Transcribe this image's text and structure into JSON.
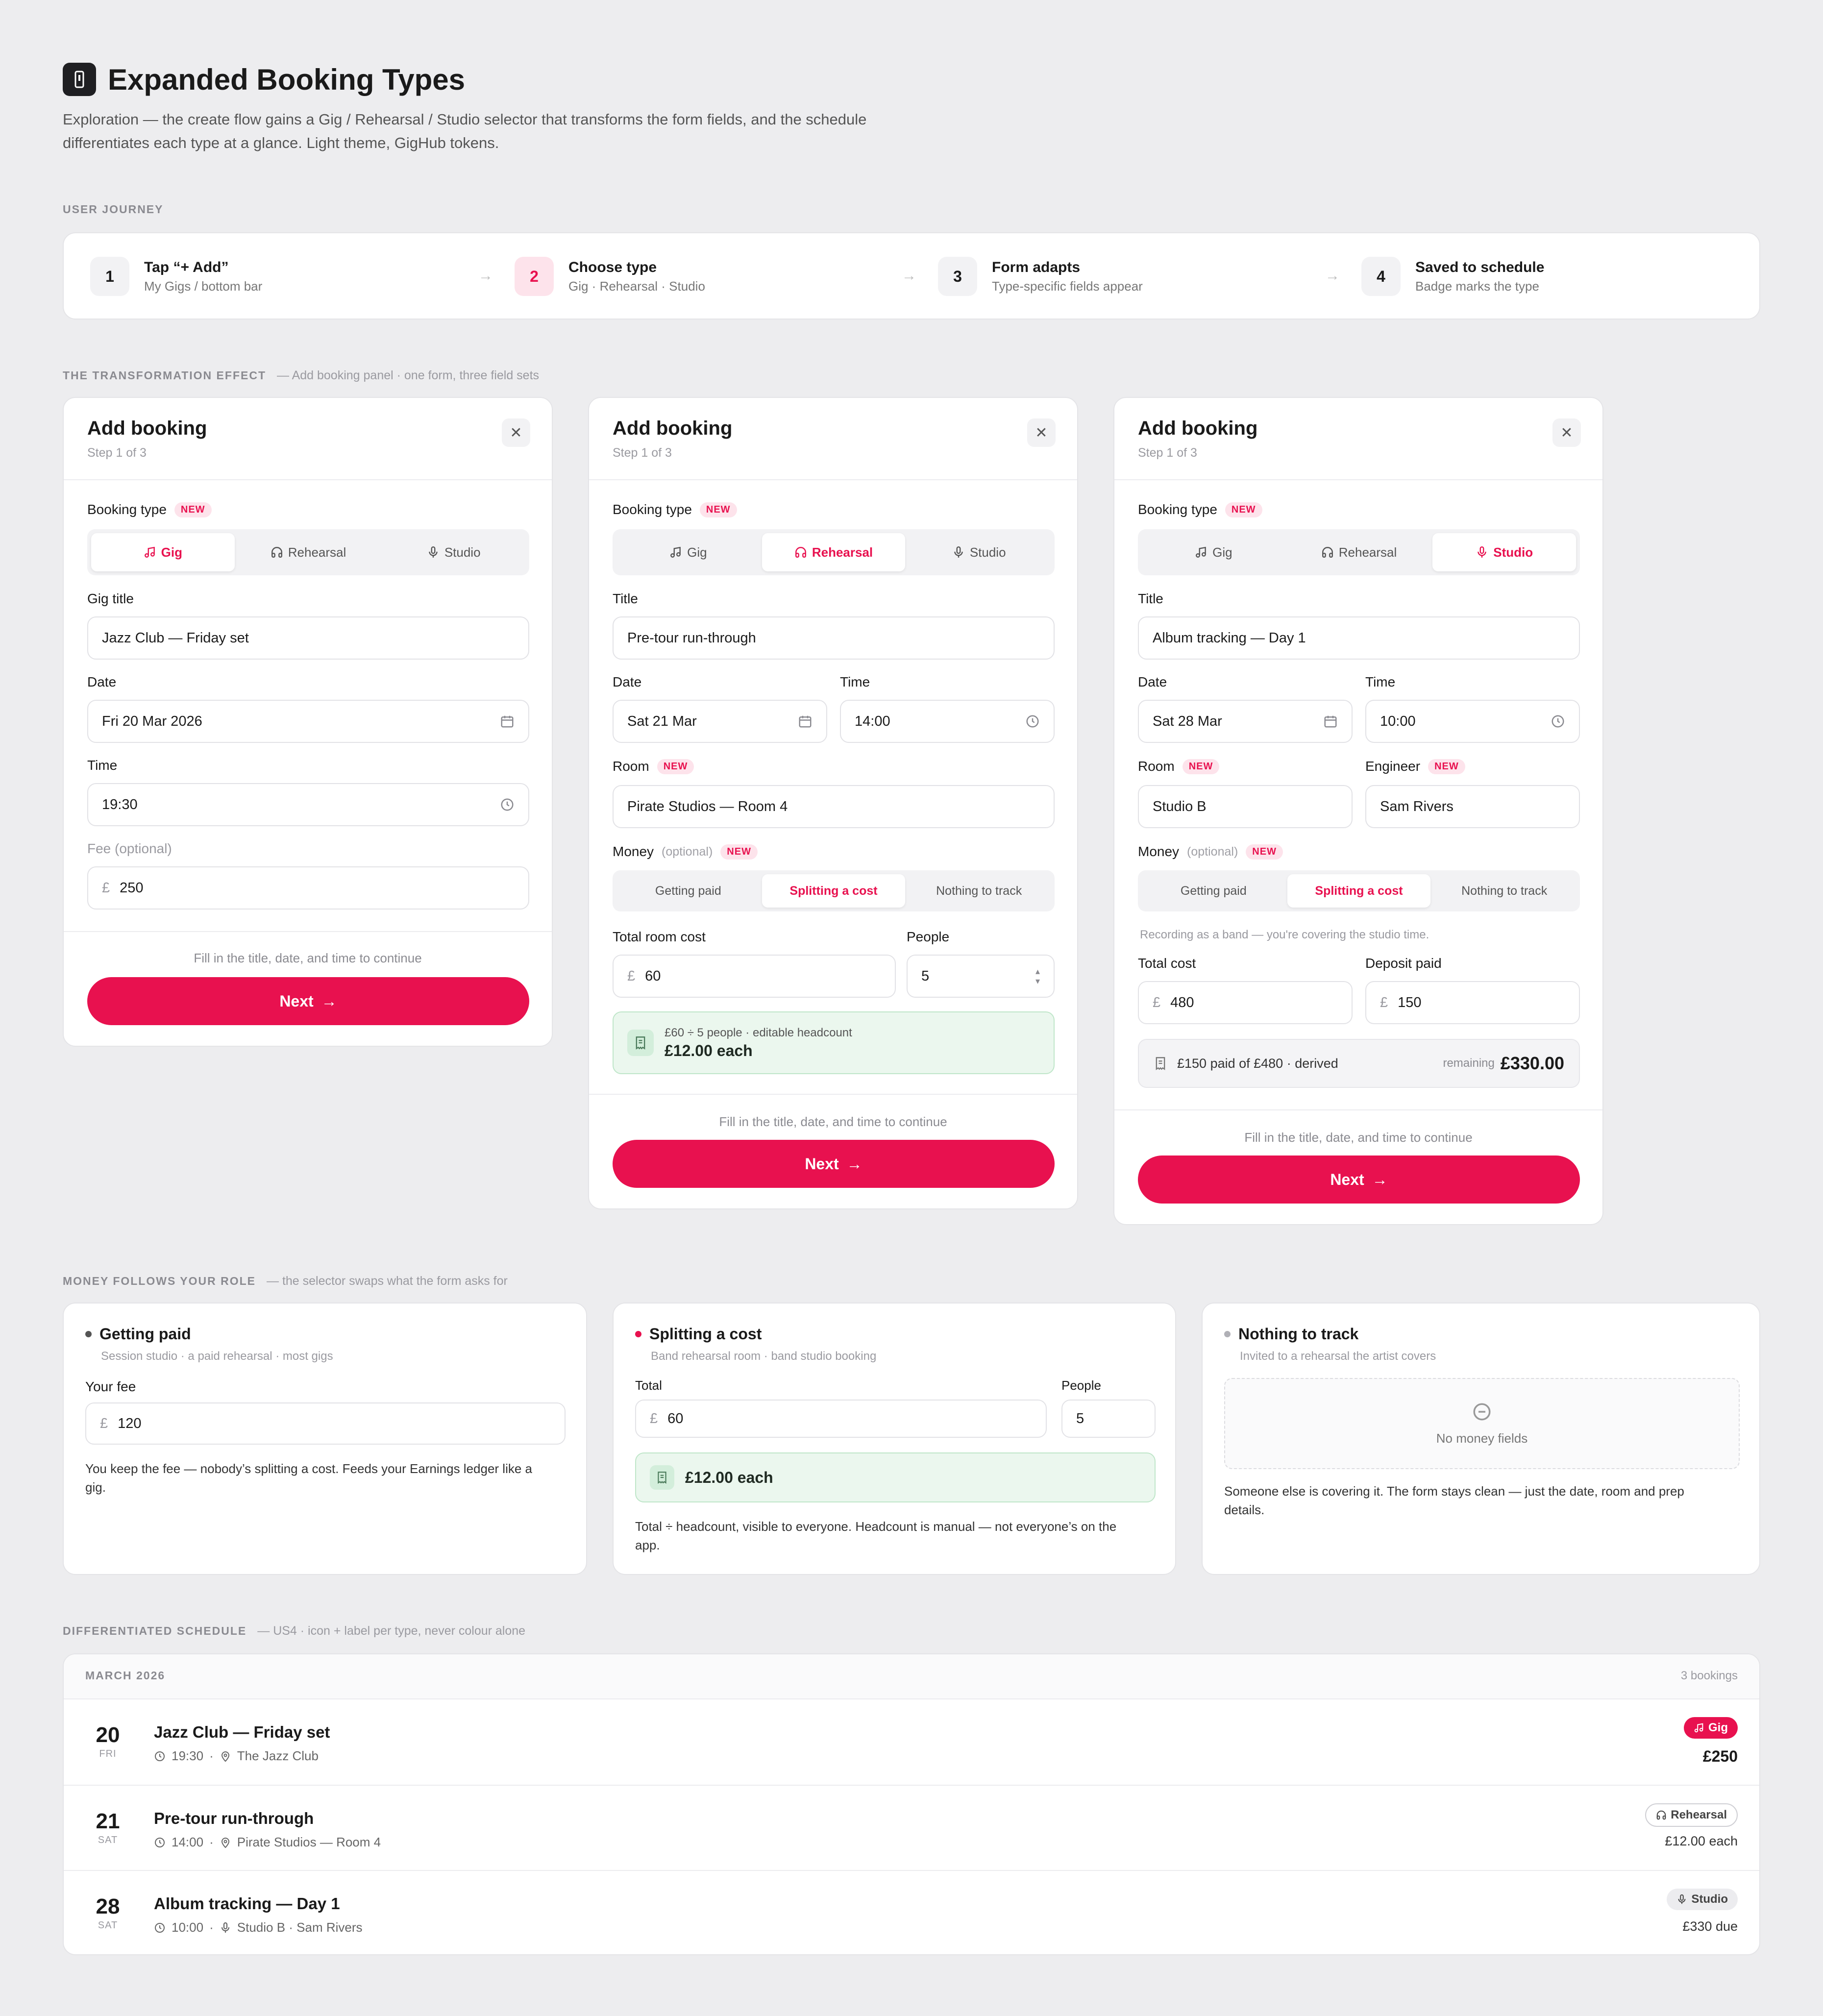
{
  "header": {
    "title": "Expanded Booking Types",
    "desc_line1": "Exploration — the create flow gains a Gig / Rehearsal / Studio selector that transforms the form fields, and the schedule",
    "desc_line2": "differentiates each type at a glance. Light theme, GigHub tokens.",
    "logo_icon": "phone-icon"
  },
  "journey": {
    "label": "USER JOURNEY",
    "steps": [
      {
        "num": "1",
        "title": "Tap “+ Add”",
        "sub": "My Gigs / bottom bar"
      },
      {
        "num": "2",
        "title": "Choose type",
        "sub": "Gig · Rehearsal · Studio"
      },
      {
        "num": "3",
        "title": "Form adapts",
        "sub": "Type-specific fields appear"
      },
      {
        "num": "4",
        "title": "Saved to schedule",
        "sub": "Badge marks the type"
      }
    ]
  },
  "transform": {
    "label": "THE TRANSFORMATION EFFECT",
    "sub": "— Add booking panel · one form, three field sets"
  },
  "common": {
    "panel_title": "Add booking",
    "panel_step": "Step 1 of 3",
    "booking_type_label": "Booking type",
    "new_badge": "NEW",
    "types": [
      "Gig",
      "Rehearsal",
      "Studio"
    ],
    "hint": "Fill in the title, date, and time to continue",
    "next": "Next",
    "currency": "£",
    "money_label": "Money",
    "money_optional": "(optional)",
    "money_options": [
      "Getting paid",
      "Splitting a cost",
      "Nothing to track"
    ],
    "accent": "#e8114f"
  },
  "gig_panel": {
    "title_label": "Gig title",
    "title_value": "Jazz Club — Friday set",
    "date_label": "Date",
    "date_value": "Fri 20 Mar 2026",
    "time_label": "Time",
    "time_value": "19:30",
    "fee_label": "Fee (optional)",
    "fee_value": "250"
  },
  "rehearsal_panel": {
    "title_label": "Title",
    "title_value": "Pre-tour run-through",
    "date_label": "Date",
    "date_value": "Sat 21 Mar",
    "time_label": "Time",
    "time_value": "14:00",
    "room_label": "Room",
    "room_value": "Pirate Studios — Room 4",
    "total_label": "Total room cost",
    "total_value": "60",
    "people_label": "People",
    "people_value": "5",
    "calc_line": "£60 ÷ 5 people · editable headcount",
    "calc_value": "£12.00 each"
  },
  "studio_panel": {
    "title_label": "Title",
    "title_value": "Album tracking — Day 1",
    "date_label": "Date",
    "date_value": "Sat 28 Mar",
    "time_label": "Time",
    "time_value": "10:00",
    "room_label": "Room",
    "room_value": "Studio B",
    "engineer_label": "Engineer",
    "engineer_value": "Sam Rivers",
    "note": "Recording as a band — you're covering the studio time.",
    "total_label": "Total cost",
    "total_value": "480",
    "deposit_label": "Deposit paid",
    "deposit_value": "150",
    "summary_text": "£150 paid of £480 · derived",
    "remaining_label": "remaining",
    "remaining_value": "£330.00"
  },
  "money": {
    "label": "MONEY FOLLOWS YOUR ROLE",
    "sub": "— the selector swaps what the form asks for",
    "paid": {
      "title": "Getting paid",
      "sub": "Session studio · a paid rehearsal · most gigs",
      "fee_label": "Your fee",
      "fee_value": "120",
      "desc_line1": "You keep the fee — nobody’s splitting a cost. Feeds your Earnings ledger like a",
      "desc_line2": "gig."
    },
    "split": {
      "title": "Splitting a cost",
      "sub": "Band rehearsal room · band studio booking",
      "total_label": "Total",
      "total_value": "60",
      "people_label": "People",
      "people_value": "5",
      "each": "£12.00 each",
      "desc_line1": "Total ÷ headcount, visible to everyone. Headcount is manual — not everyone’s on the",
      "desc_line2": "app."
    },
    "none": {
      "title": "Nothing to track",
      "sub": "Invited to a rehearsal the artist covers",
      "empty": "No money fields",
      "desc_line1": "Someone else is covering it. The form stays clean — just the date, room and prep",
      "desc_line2": "details."
    }
  },
  "schedule": {
    "label": "DIFFERENTIATED SCHEDULE",
    "sub": "— US4 · icon + label per type, never colour alone",
    "month": "MARCH 2026",
    "count": "3 bookings",
    "rows": [
      {
        "day": "20",
        "weekday": "FRI",
        "title": "Jazz Club — Friday set",
        "time": "19:30",
        "place": "The Jazz Club",
        "badge": "Gig",
        "amount": "£250"
      },
      {
        "day": "21",
        "weekday": "SAT",
        "title": "Pre-tour run-through",
        "time": "14:00",
        "place": "Pirate Studios — Room 4",
        "badge": "Rehearsal",
        "amount": "£12.00 each"
      },
      {
        "day": "28",
        "weekday": "SAT",
        "title": "Album tracking — Day 1",
        "time": "10:00",
        "place": "Studio B · Sam Rivers",
        "badge": "Studio",
        "amount": "£330 due"
      }
    ]
  }
}
